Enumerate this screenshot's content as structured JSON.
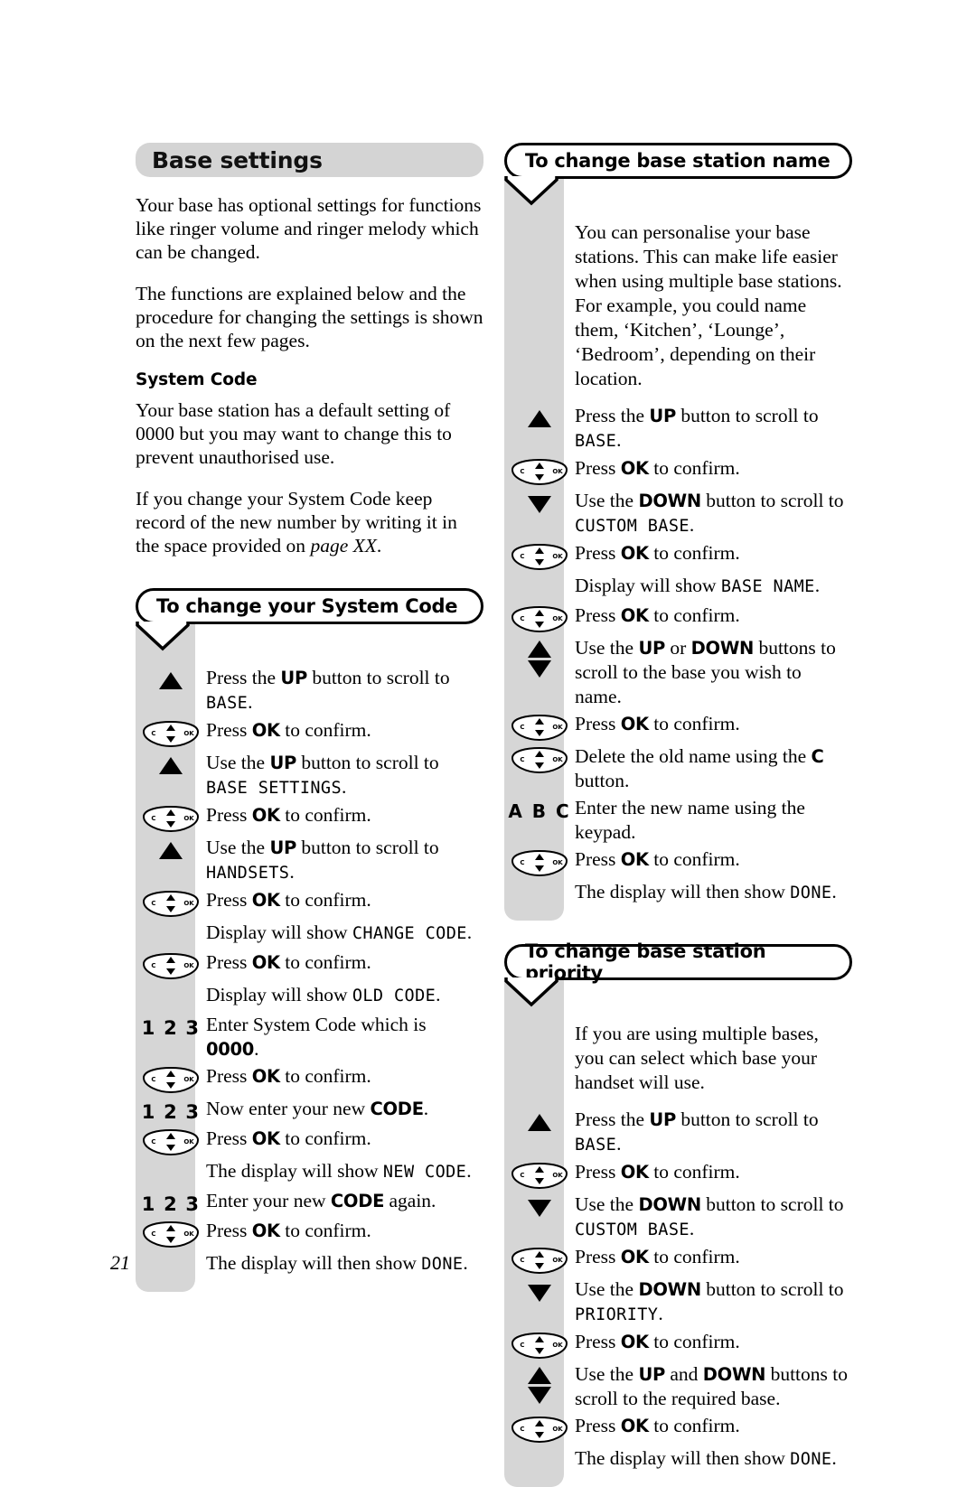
{
  "page": {
    "number": "21"
  },
  "left_column": {
    "section_title": "Base settings",
    "intro_paragraphs": [
      "Your base has optional settings for functions like ringer volume and ringer melody which can be changed.",
      "The functions are explained below and the procedure for changing the settings is shown on the next few pages."
    ],
    "subhead": "System Code",
    "system_code_paragraphs": [
      "Your base station has a default setting of 0000 but you may want to change this to prevent unauthorised use.",
      "If you change your System Code keep record of the new number by writing it in the space provided on "
    ],
    "page_ref": "page XX",
    "page_ref_end": ".",
    "callout_title": "To change your System Code",
    "steps": [
      {
        "icon": "up-arrow-icon",
        "text_pre": "Press the ",
        "key": "UP",
        "text_mid": " button to scroll to ",
        "lcd": "BASE",
        "text_post": "."
      },
      {
        "icon": "nav-key-icon",
        "text_pre": "Press ",
        "key": "OK",
        "text_mid": " to confirm.",
        "lcd": "",
        "text_post": ""
      },
      {
        "icon": "up-arrow-icon",
        "text_pre": "Use the ",
        "key": "UP",
        "text_mid": " button to scroll to ",
        "lcd": "BASE SETTINGS",
        "text_post": "."
      },
      {
        "icon": "nav-key-icon",
        "text_pre": "Press ",
        "key": "OK",
        "text_mid": " to confirm.",
        "lcd": "",
        "text_post": ""
      },
      {
        "icon": "up-arrow-icon",
        "text_pre": "Use the ",
        "key": "UP",
        "text_mid": " button to scroll to ",
        "lcd": "HANDSETS",
        "text_post": "."
      },
      {
        "icon": "nav-key-icon",
        "text_pre": "Press ",
        "key": "OK",
        "text_mid": " to confirm.",
        "lcd": "",
        "text_post": ""
      },
      {
        "icon": "none",
        "text_pre": "Display will show ",
        "key": "",
        "text_mid": "",
        "lcd": "CHANGE CODE",
        "text_post": "."
      },
      {
        "icon": "nav-key-icon",
        "text_pre": "Press ",
        "key": "OK",
        "text_mid": " to confirm.",
        "lcd": "",
        "text_post": ""
      },
      {
        "icon": "none",
        "text_pre": "Display will show ",
        "key": "",
        "text_mid": "",
        "lcd": "OLD CODE",
        "text_post": "."
      },
      {
        "icon": "keypad-123-icon",
        "text_pre": "Enter System Code which is ",
        "key": "0000",
        "text_mid": ".",
        "lcd": "",
        "text_post": ""
      },
      {
        "icon": "nav-key-icon",
        "text_pre": "Press ",
        "key": "OK",
        "text_mid": " to confirm.",
        "lcd": "",
        "text_post": ""
      },
      {
        "icon": "keypad-123-icon",
        "text_pre": "Now enter your new ",
        "key": "CODE",
        "text_mid": ".",
        "lcd": "",
        "text_post": ""
      },
      {
        "icon": "nav-key-icon",
        "text_pre": "Press ",
        "key": "OK",
        "text_mid": " to confirm.",
        "lcd": "",
        "text_post": ""
      },
      {
        "icon": "none",
        "text_pre": "The display will show ",
        "key": "",
        "text_mid": "",
        "lcd": "NEW CODE",
        "text_post": "."
      },
      {
        "icon": "keypad-123-icon",
        "text_pre": "Enter your new ",
        "key": "CODE",
        "text_mid": " again.",
        "lcd": "",
        "text_post": ""
      },
      {
        "icon": "nav-key-icon",
        "text_pre": "Press ",
        "key": "OK",
        "text_mid": " to confirm.",
        "lcd": "",
        "text_post": ""
      },
      {
        "icon": "none",
        "text_pre": "The display will then show ",
        "key": "",
        "text_mid": "",
        "lcd": "DONE",
        "text_post": "."
      }
    ]
  },
  "right_column": {
    "name_section": {
      "callout_title": "To change base station name",
      "intro": "You can personalise your base stations. This can make life easier when using multiple base stations. For example, you could name them, ‘Kitchen’, ‘Lounge’, ‘Bedroom’, depending on their location.",
      "steps": [
        {
          "icon": "up-arrow-icon",
          "text_pre": "Press the ",
          "key": "UP",
          "text_mid": " button to scroll to ",
          "lcd": "BASE",
          "text_post": "."
        },
        {
          "icon": "nav-key-icon",
          "text_pre": "Press ",
          "key": "OK",
          "text_mid": " to confirm.",
          "lcd": "",
          "text_post": ""
        },
        {
          "icon": "down-arrow-icon",
          "text_pre": "Use the ",
          "key": "DOWN",
          "text_mid": " button to scroll to ",
          "lcd": "CUSTOM BASE",
          "text_post": "."
        },
        {
          "icon": "nav-key-icon",
          "text_pre": "Press ",
          "key": "OK",
          "text_mid": " to confirm.",
          "lcd": "",
          "text_post": ""
        },
        {
          "icon": "none",
          "text_pre": "Display will show ",
          "key": "",
          "text_mid": "",
          "lcd": "BASE NAME",
          "text_post": "."
        },
        {
          "icon": "nav-key-icon",
          "text_pre": "Press ",
          "key": "OK",
          "text_mid": " to confirm.",
          "lcd": "",
          "text_post": ""
        },
        {
          "icon": "up-down-arrow-icon",
          "text_pre": "Use the ",
          "key": "UP",
          "text_mid2": " or ",
          "key2": "DOWN",
          "text_mid": " buttons to scroll to the base you wish to name.",
          "lcd": "",
          "text_post": ""
        },
        {
          "icon": "nav-key-icon",
          "text_pre": "Press ",
          "key": "OK",
          "text_mid": " to confirm.",
          "lcd": "",
          "text_post": ""
        },
        {
          "icon": "nav-key-icon",
          "text_pre": "Delete the old name using the ",
          "key": "C",
          "text_mid": " button.",
          "lcd": "",
          "text_post": ""
        },
        {
          "icon": "keypad-abc-icon",
          "text_pre": "Enter the new name using the keypad.",
          "key": "",
          "text_mid": "",
          "lcd": "",
          "text_post": ""
        },
        {
          "icon": "nav-key-icon",
          "text_pre": "Press ",
          "key": "OK",
          "text_mid": " to confirm.",
          "lcd": "",
          "text_post": ""
        },
        {
          "icon": "none",
          "text_pre": "The display will then show ",
          "key": "",
          "text_mid": "",
          "lcd": "DONE",
          "text_post": "."
        }
      ]
    },
    "priority_section": {
      "callout_title": "To change base station priority",
      "intro": "If you are using multiple bases, you can select which base your handset will use.",
      "steps": [
        {
          "icon": "up-arrow-icon",
          "text_pre": "Press the ",
          "key": "UP",
          "text_mid": " button to scroll to ",
          "lcd": "BASE",
          "text_post": "."
        },
        {
          "icon": "nav-key-icon",
          "text_pre": "Press ",
          "key": "OK",
          "text_mid": " to confirm.",
          "lcd": "",
          "text_post": ""
        },
        {
          "icon": "down-arrow-icon",
          "text_pre": "Use the ",
          "key": "DOWN",
          "text_mid": " button to scroll to ",
          "lcd": "CUSTOM BASE",
          "text_post": "."
        },
        {
          "icon": "nav-key-icon",
          "text_pre": "Press ",
          "key": "OK",
          "text_mid": " to confirm.",
          "lcd": "",
          "text_post": ""
        },
        {
          "icon": "down-arrow-icon",
          "text_pre": "Use the ",
          "key": "DOWN",
          "text_mid": " button to scroll to ",
          "lcd": "PRIORITY",
          "text_post": "."
        },
        {
          "icon": "nav-key-icon",
          "text_pre": "Press ",
          "key": "OK",
          "text_mid": " to confirm.",
          "lcd": "",
          "text_post": ""
        },
        {
          "icon": "up-down-arrow-icon",
          "text_pre": "Use the ",
          "key": "UP",
          "text_mid2": " and ",
          "key2": "DOWN",
          "text_mid": " buttons to scroll to the required base.",
          "lcd": "",
          "text_post": ""
        },
        {
          "icon": "nav-key-icon",
          "text_pre": "Press ",
          "key": "OK",
          "text_mid": " to confirm.",
          "lcd": "",
          "text_post": ""
        },
        {
          "icon": "none",
          "text_pre": "The display will then show ",
          "key": "",
          "text_mid": "",
          "lcd": "DONE",
          "text_post": "."
        }
      ]
    }
  },
  "icons": {
    "nav_key": {
      "left_label": "C",
      "right_label": "OK"
    },
    "keypad_123": "1 2 3",
    "keypad_abc": "A B C"
  },
  "colors": {
    "strip_gray": "#d6d6d6",
    "title_gray": "#d4d4d4",
    "ink": "#000000"
  }
}
